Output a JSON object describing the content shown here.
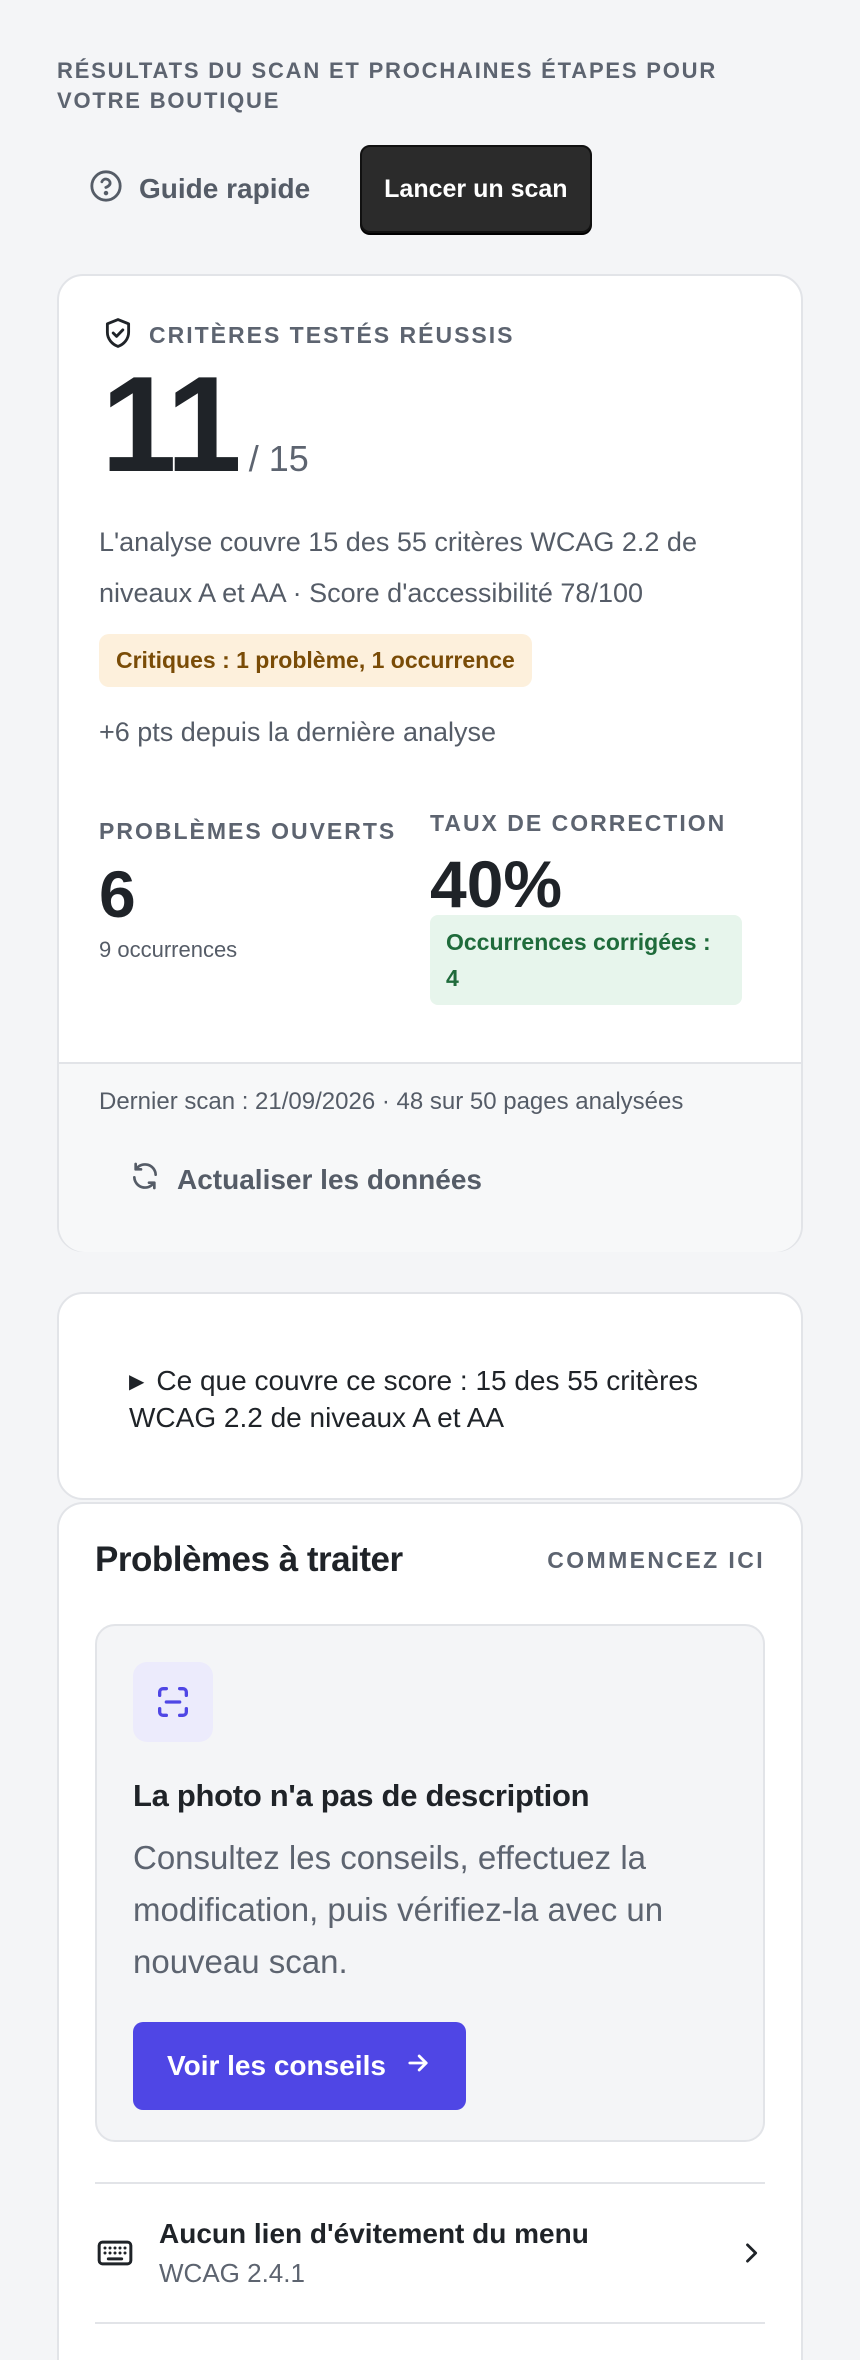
{
  "page": {
    "eyebrow": "RÉSULTATS DU SCAN ET PROCHAINES ÉTAPES POUR VOTRE BOUTIQUE"
  },
  "toolbar": {
    "guide_label": "Guide rapide",
    "guide_icon": "help-circle-icon",
    "scan_label": "Lancer un scan"
  },
  "score_card": {
    "eyebrow": "CRITÈRES TESTÉS RÉUSSIS",
    "eyebrow_icon": "shield-check-icon",
    "passed": "11",
    "total": "/ 15",
    "description": "L'analyse couvre 15 des 55 critères WCAG 2.2 de niveaux A et AA · Score d'accessibilité 78/100",
    "critical_badge": "Critiques : 1 problème, 1 occurrence",
    "delta": "+6 pts depuis la dernière analyse",
    "open_issues": {
      "label": "PROBLÈMES OUVERTS",
      "value": "6",
      "sub": "9 occurrences"
    },
    "fix_rate": {
      "label": "TAUX DE CORRECTION",
      "value": "40%",
      "badge": "Occurrences corrigées : 4"
    },
    "last_scan": "Dernier scan : 21/09/2026 · 48 sur 50 pages analysées",
    "refresh_label": "Actualiser les données",
    "refresh_icon": "refresh-icon"
  },
  "details": {
    "summary": "Ce que couvre ce score : 15 des 55 critères WCAG 2.2 de niveaux A et AA"
  },
  "issues": {
    "title": "Problèmes à traiter",
    "eyebrow": "COMMENCEZ ICI",
    "featured": {
      "icon": "scan-icon",
      "title": "La photo n'a pas de description",
      "description": "Consultez les conseils, effectuez la modification, puis vérifiez-la avec un nouveau scan.",
      "button_label": "Voir les conseils",
      "button_icon": "arrow-right-icon"
    },
    "rows": [
      {
        "icon": "keyboard-icon",
        "title": "Aucun lien d'évitement du menu",
        "criterion": "WCAG 2.4.1"
      }
    ]
  },
  "colors": {
    "accent": "#4f46e5",
    "warning_bg": "#fdf0dc",
    "success_bg": "#e7f5ec",
    "dark_button": "#2b2b2b"
  }
}
